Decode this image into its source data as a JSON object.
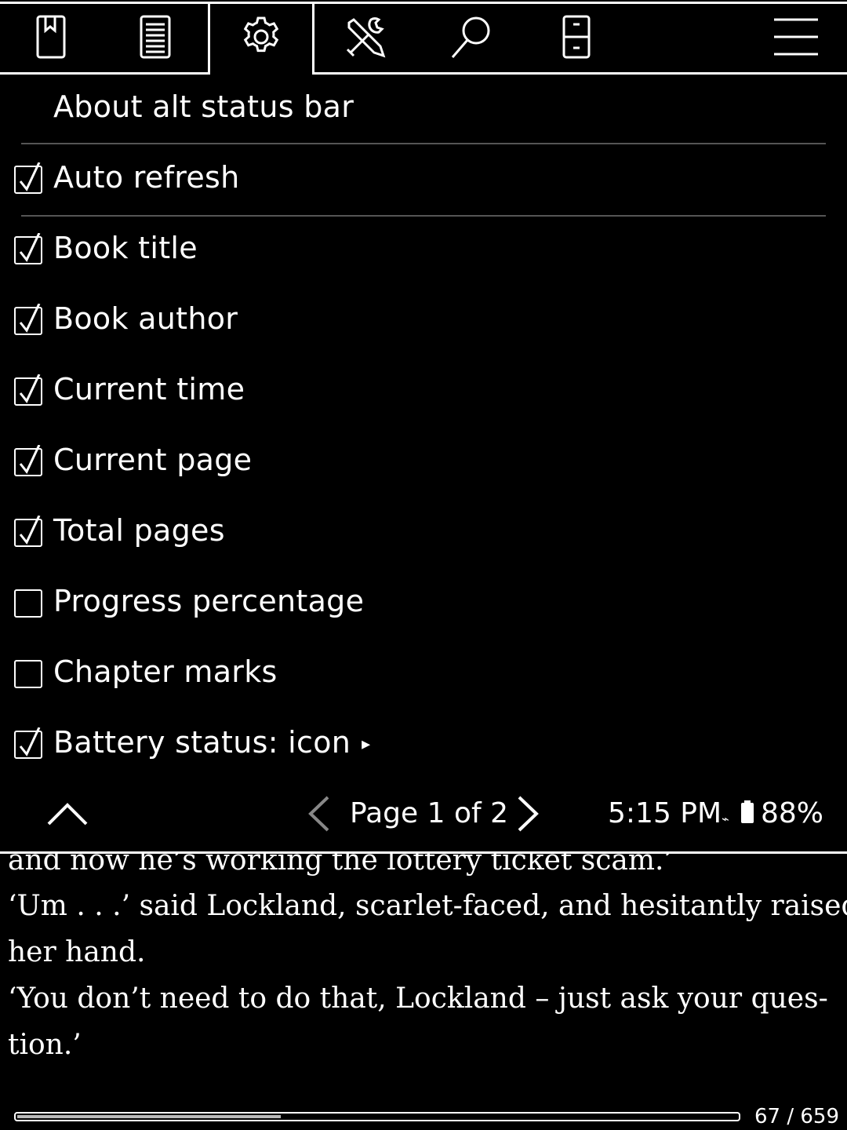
{
  "tabs": [
    {
      "name": "bookmark-icon"
    },
    {
      "name": "toc-icon"
    },
    {
      "name": "gear-icon",
      "active": true
    },
    {
      "name": "tools-icon"
    },
    {
      "name": "search-icon"
    },
    {
      "name": "device-icon"
    },
    {
      "name": "hamburger-menu-icon"
    }
  ],
  "menu": {
    "header": "About alt status bar",
    "items": [
      {
        "label": "Auto refresh",
        "checked": true
      },
      {
        "label": "Book title",
        "checked": true
      },
      {
        "label": "Book author",
        "checked": true
      },
      {
        "label": "Current time",
        "checked": true
      },
      {
        "label": "Current page",
        "checked": true
      },
      {
        "label": "Total pages",
        "checked": true
      },
      {
        "label": "Progress percentage",
        "checked": false
      },
      {
        "label": "Chapter marks",
        "checked": false
      },
      {
        "label": "Battery status: icon",
        "checked": true,
        "submenu": "▸"
      }
    ]
  },
  "menu_footer": {
    "page_text": "Page 1 of 2",
    "time": "5:15 PM",
    "battery_pct": "88%"
  },
  "book": {
    "lines": [
      "and now he’s working the lottery ticket scam.’",
      "    ‘Um . . .’ said Lockland, scarlet-faced, and hesitantly raised",
      "her hand.",
      "    ‘You don’t need to do that, Lockland – just ask your ques-",
      "tion.’"
    ]
  },
  "progress": {
    "current_page": 67,
    "total_pages": 659,
    "label": "67 / 659"
  },
  "colors": {
    "background": "#000000",
    "foreground": "#ffffff",
    "separator": "#555555"
  }
}
